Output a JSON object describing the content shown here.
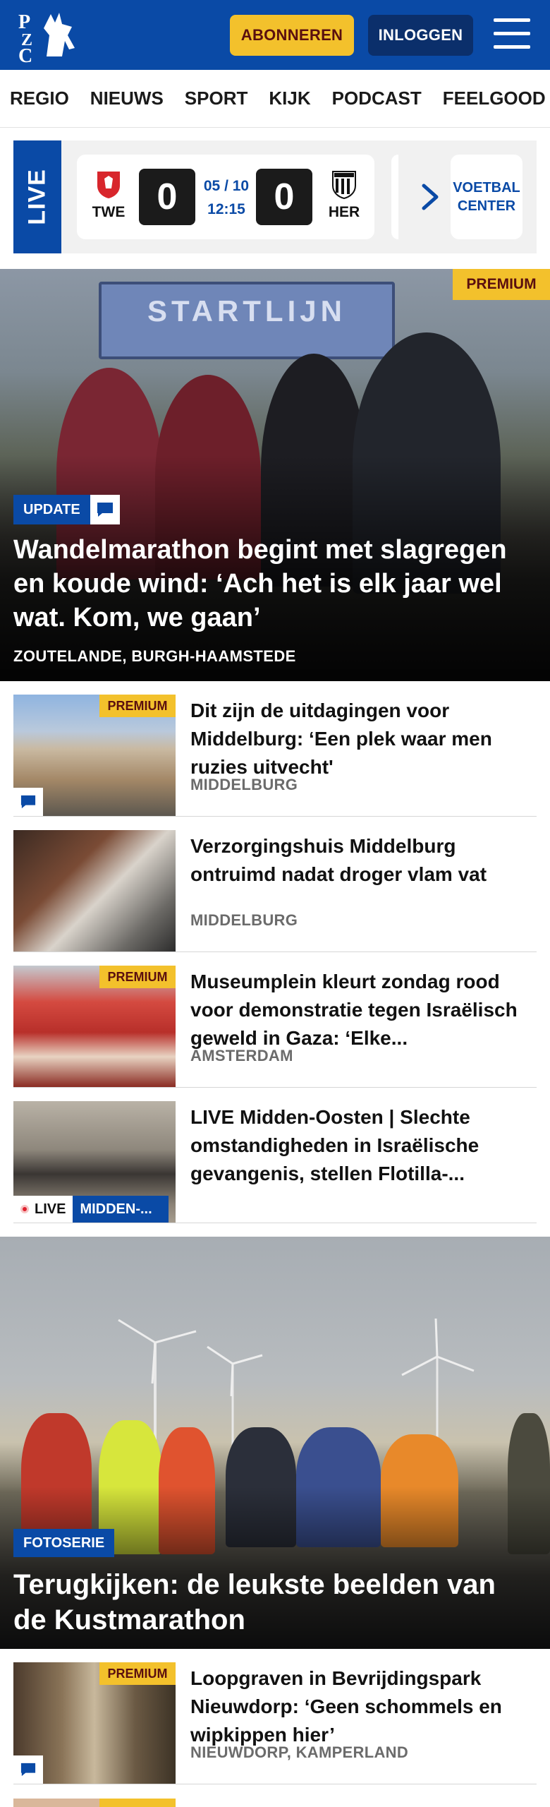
{
  "header": {
    "brand": "PZC",
    "subscribe_label": "ABONNEREN",
    "login_label": "INLOGGEN",
    "colors": {
      "brand_blue": "#0a4aa6",
      "accent_yellow": "#f3c12c"
    }
  },
  "nav": {
    "items": [
      "REGIO",
      "NIEUWS",
      "SPORT",
      "KIJK",
      "PODCAST",
      "FEELGOOD"
    ]
  },
  "live": {
    "label": "LIVE",
    "match": {
      "home_code": "TWE",
      "away_code": "HER",
      "home_score": "0",
      "away_score": "0",
      "date": "05 / 10",
      "time": "12:15"
    },
    "voetbal_center_label": "VOETBAL CENTER"
  },
  "hero": {
    "premium_label": "PREMIUM",
    "arch_text": "STARTLIJN",
    "badge_label": "UPDATE",
    "title": "Wandelmarathon begint met slagregen en koude wind: ‘Ach het is elk jaar wel wat. Kom, we gaan’",
    "place": "ZOUTELANDE, BURGH-HAAMSTEDE"
  },
  "articles": [
    {
      "title": "Dit zijn de uitdagingen voor Middelburg: ‘Een plek waar men ruzies uitvecht'",
      "place": "MIDDELBURG",
      "premium_label": "PREMIUM"
    },
    {
      "title": "Verzorgingshuis Middelburg ontruimd nadat droger vlam vat",
      "place": "MIDDELBURG"
    },
    {
      "title": "Museumplein kleurt zondag rood voor demonstratie tegen Israëlisch geweld in Gaza: ‘Elke...",
      "place": "AMSTERDAM",
      "premium_label": "PREMIUM"
    },
    {
      "title": "LIVE Midden-Oosten | Slechte omstandigheden in Israëlische gevangenis, stellen Flotilla-...",
      "live_label": "LIVE",
      "topic_label": "MIDDEN-..."
    }
  ],
  "photo_series": {
    "badge_label": "FOTOSERIE",
    "title": "Terugkijken: de leukste beelden van de Kustmarathon"
  },
  "articles_after": [
    {
      "title": "Loopgraven in Bevrijdingspark Nieuwdorp: ‘Geen schommels en wipkippen hier’",
      "place": "NIEUWDORP, KAMPERLAND",
      "premium_label": "PREMIUM"
    }
  ]
}
